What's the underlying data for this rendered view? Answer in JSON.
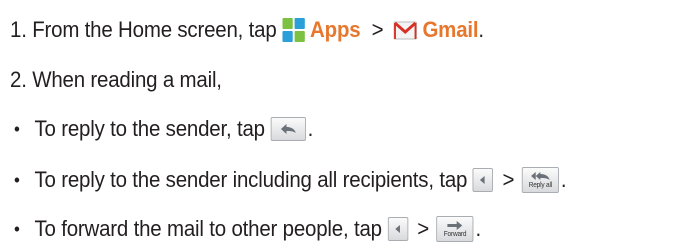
{
  "steps": {
    "step1": {
      "prefix": "1. From the Home screen, tap",
      "apps_label": "Apps",
      "separator": ">",
      "gmail_label": "Gmail",
      "end": "."
    },
    "step2": {
      "text": "2. When reading a mail,"
    }
  },
  "bullets": [
    {
      "marker": "•",
      "text": "To reply to the sender, tap",
      "end": "."
    },
    {
      "marker": "•",
      "text": "To reply to the sender including all recipients, tap",
      "separator": ">",
      "button_label": "Reply all",
      "end": "."
    },
    {
      "marker": "•",
      "text": "To forward the mail to other people, tap",
      "separator": ">",
      "button_label": "Forward",
      "end": "."
    }
  ],
  "colors": {
    "accent": "#e8772e",
    "text": "#231f20"
  },
  "icons": {
    "apps": "apps-grid-icon",
    "gmail": "gmail-envelope-icon",
    "reply": "reply-arrow-icon",
    "menu": "menu-arrow-icon",
    "reply_all": "reply-all-arrow-icon",
    "forward": "forward-arrow-icon"
  }
}
